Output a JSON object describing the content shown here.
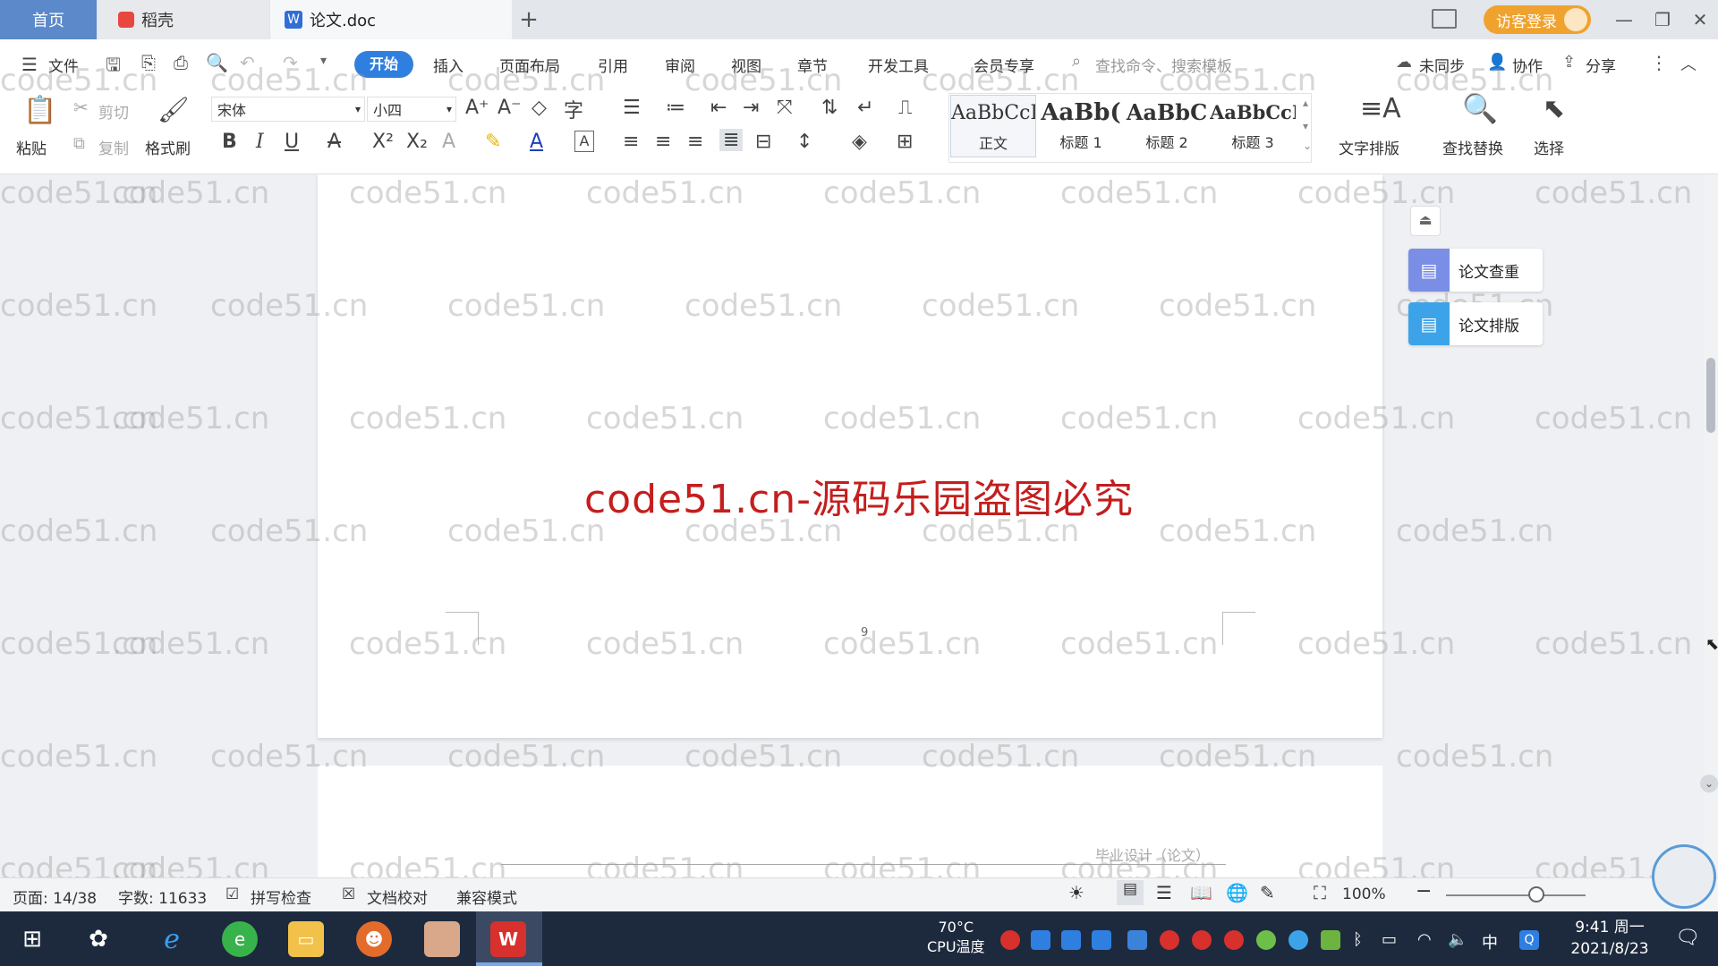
{
  "tabs": {
    "home": "首页",
    "daoke": "稻壳",
    "doc": "论文.doc"
  },
  "login": {
    "label": "访客登录"
  },
  "menu": {
    "file": "文件",
    "items": [
      "开始",
      "插入",
      "页面布局",
      "引用",
      "审阅",
      "视图",
      "章节",
      "开发工具",
      "会员专享"
    ],
    "search_placeholder": "查找命令、搜索模板",
    "sync": "未同步",
    "collab": "协作",
    "share": "分享"
  },
  "ribbon": {
    "paste": "粘贴",
    "cut": "剪切",
    "copy": "复制",
    "format_painter": "格式刷",
    "font_name": "宋体",
    "font_size": "小四",
    "styles": [
      {
        "sample": "AaBbCcI",
        "name": "正文"
      },
      {
        "sample": "AaBb(",
        "name": "标题 1"
      },
      {
        "sample": "AaBbC",
        "name": "标题 2"
      },
      {
        "sample": "AaBbCcI",
        "name": "标题 3"
      }
    ],
    "text_layout": "文字排版",
    "find_replace": "查找替换",
    "select": "选择"
  },
  "document": {
    "center_watermark": "code51.cn-源码乐园盗图必究",
    "page_number": "9",
    "next_page_header": "毕业设计（论文）",
    "watermark_text": "code51.cn"
  },
  "side_panel": {
    "check": "论文查重",
    "layout": "论文排版"
  },
  "status": {
    "page": "页面: 14/38",
    "words": "字数: 11633",
    "spell": "拼写检查",
    "proof": "文档校对",
    "compat": "兼容模式",
    "zoom": "100%"
  },
  "taskbar": {
    "cpu_temp": "70°C",
    "cpu_label": "CPU温度",
    "time": "9:41 周一",
    "date": "2021/8/23",
    "ime": "中"
  }
}
